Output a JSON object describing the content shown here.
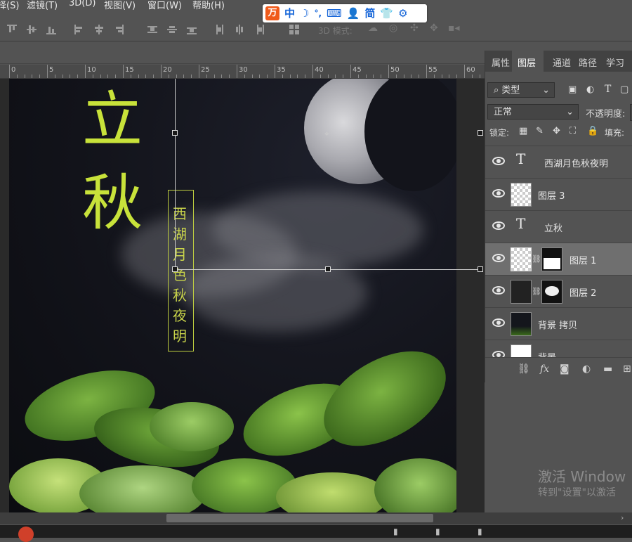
{
  "menu": {
    "items": [
      "择(S)",
      "滤镜(T)",
      "3D(D)",
      "视图(V)",
      "窗口(W)",
      "帮助(H)"
    ]
  },
  "ime": {
    "logo": "万",
    "chinese_mode": "中",
    "traditional": "简"
  },
  "options_bar": {
    "mode_3d_label": "3D 模式:"
  },
  "ruler": {
    "labels": [
      "0",
      "5",
      "10",
      "15",
      "20",
      "25",
      "30",
      "35",
      "40",
      "45",
      "50",
      "55",
      "60"
    ]
  },
  "canvas": {
    "title_text": "立秋",
    "vertical_text": "西湖月色秋夜明",
    "title_color": "#c8e23a"
  },
  "panel": {
    "tabs": [
      "属性",
      "图层",
      "通道",
      "路径",
      "学习"
    ],
    "active_tab": "图层",
    "filter_label": "类型",
    "blend_mode": "正常",
    "opacity_label": "不透明度:",
    "lock_label": "锁定:",
    "fill_label": "填充:",
    "layers": [
      {
        "name": "西湖月色秋夜明",
        "kind": "text"
      },
      {
        "name": "图层 3",
        "kind": "pixel"
      },
      {
        "name": "立秋",
        "kind": "text"
      },
      {
        "name": "图层 1",
        "kind": "masked",
        "selected": true
      },
      {
        "name": "图层 2",
        "kind": "masked"
      },
      {
        "name": "背景 拷贝",
        "kind": "pixel"
      },
      {
        "name": "背景",
        "kind": "pixel"
      }
    ],
    "footer_fx": "fx"
  },
  "watermark": {
    "line1": "激活 Window",
    "line2": "转到\"设置\"以激活"
  }
}
